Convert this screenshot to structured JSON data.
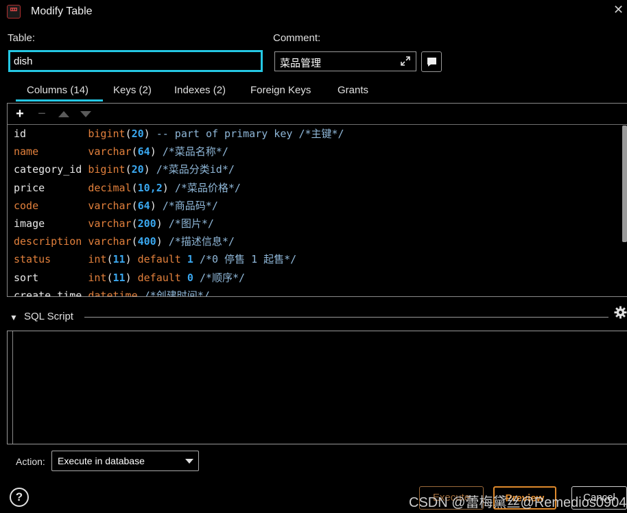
{
  "window": {
    "title": "Modify Table",
    "icon_text": "罒",
    "close_label": "✕"
  },
  "table": {
    "label": "Table:",
    "value": "dish"
  },
  "comment": {
    "label": "Comment:",
    "value": "菜品管理"
  },
  "tabs": [
    {
      "label": "Columns (14)",
      "active": true
    },
    {
      "label": "Keys (2)"
    },
    {
      "label": "Indexes (2)"
    },
    {
      "label": "Foreign Keys"
    },
    {
      "label": "Grants"
    }
  ],
  "toolbar": {
    "add": "+",
    "remove": "−"
  },
  "columns": [
    {
      "name": "id",
      "type": "bigint",
      "args": "20",
      "extra": " -- part of primary key",
      "comment": "/*主键*/"
    },
    {
      "name": "name",
      "type": "varchar",
      "args": "64",
      "extra": "",
      "comment": "/*菜品名称*/"
    },
    {
      "name": "category_id",
      "type": "bigint",
      "args": "20",
      "extra": "",
      "comment": "/*菜品分类id*/"
    },
    {
      "name": "price",
      "type": "decimal",
      "args": "10,2",
      "extra": "",
      "comment": "/*菜品价格*/"
    },
    {
      "name": "code",
      "type": "varchar",
      "args": "64",
      "extra": "",
      "comment": "/*商品码*/"
    },
    {
      "name": "image",
      "type": "varchar",
      "args": "200",
      "extra": "",
      "comment": "/*图片*/"
    },
    {
      "name": "description",
      "type": "varchar",
      "args": "400",
      "extra": "",
      "comment": "/*描述信息*/"
    },
    {
      "name": "status",
      "type": "int",
      "args": "11",
      "extra": " default 1",
      "comment": "/*0 停售 1 起售*/"
    },
    {
      "name": "sort",
      "type": "int",
      "args": "11",
      "extra": " default 0",
      "comment": "/*顺序*/"
    },
    {
      "name": "create_time",
      "type": "datetime",
      "args": "",
      "extra": "",
      "comment": "/*创建时间*/"
    }
  ],
  "sql_script": {
    "label": "SQL Script"
  },
  "action": {
    "label": "Action:",
    "selected": "Execute in database"
  },
  "buttons": {
    "help": "?",
    "execute": "Execute",
    "preview": "Preview",
    "cancel": "Cancel"
  },
  "watermark": "CSDN @蕾梅黛丝@Remedios0904",
  "colors": {
    "accent": "#25c8e4",
    "keyword": "#e2803c",
    "number": "#3aa8f0",
    "comment": "#8fb7d8"
  }
}
